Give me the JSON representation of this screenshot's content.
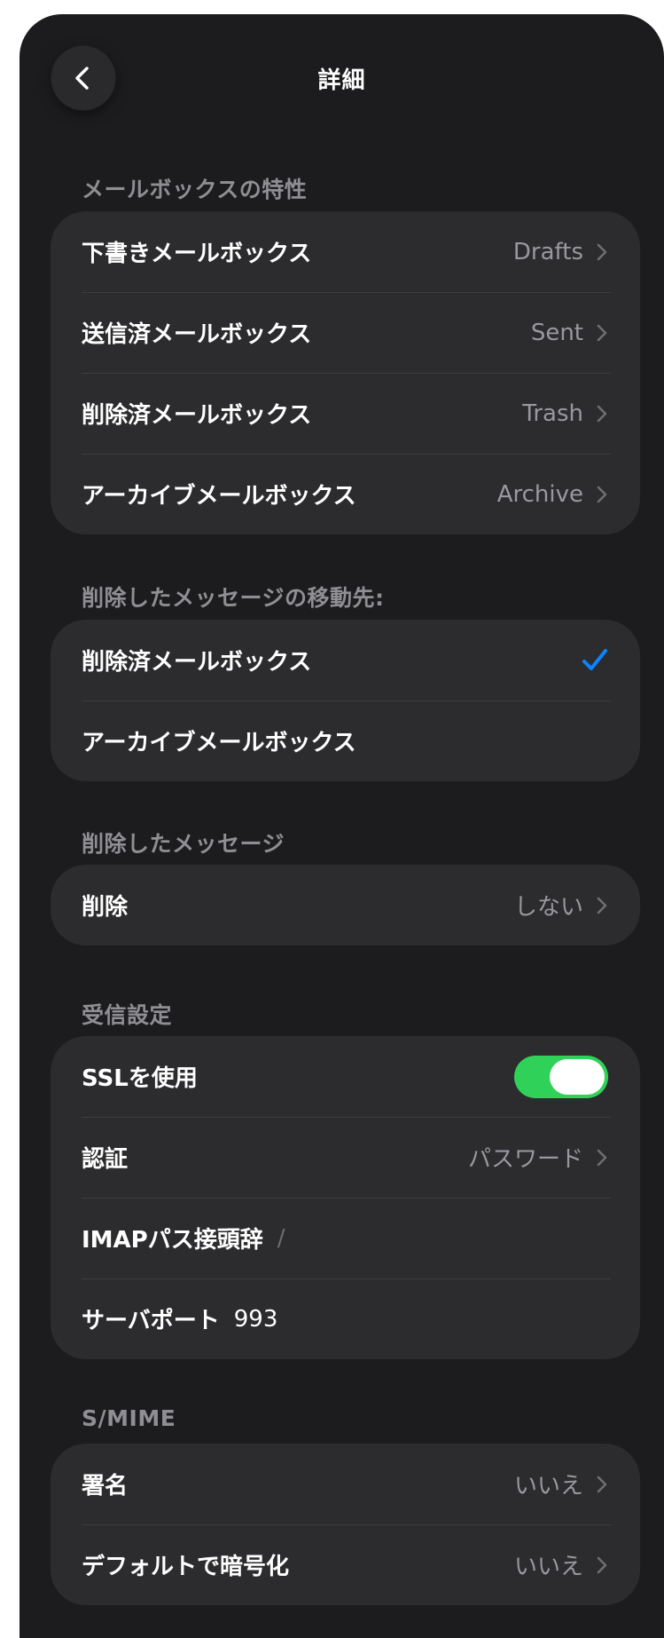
{
  "nav": {
    "title": "詳細"
  },
  "sections": {
    "mailbox": {
      "header": "メールボックスの特性",
      "rows": [
        {
          "label": "下書きメールボックス",
          "value": "Drafts"
        },
        {
          "label": "送信済メールボックス",
          "value": "Sent"
        },
        {
          "label": "削除済メールボックス",
          "value": "Trash"
        },
        {
          "label": "アーカイブメールボックス",
          "value": "Archive"
        }
      ]
    },
    "move_to": {
      "header": "削除したメッセージの移動先:",
      "rows": [
        {
          "label": "削除済メールボックス",
          "selected": true
        },
        {
          "label": "アーカイブメールボックス",
          "selected": false
        }
      ]
    },
    "deleted": {
      "header": "削除したメッセージ",
      "rows": [
        {
          "label": "削除",
          "value": "しない"
        }
      ]
    },
    "incoming": {
      "header": "受信設定",
      "ssl": {
        "label": "SSLを使用",
        "on": true
      },
      "auth": {
        "label": "認証",
        "value": "パスワード"
      },
      "imap_prefix": {
        "label": "IMAPパス接頭辞",
        "value": "/"
      },
      "server_port": {
        "label": "サーバポート",
        "value": "993"
      }
    },
    "smime": {
      "header": "S/MIME",
      "rows": [
        {
          "label": "署名",
          "value": "いいえ"
        },
        {
          "label": "デフォルトで暗号化",
          "value": "いいえ"
        }
      ]
    }
  },
  "colors": {
    "background": "#1c1c1e",
    "group": "#2c2c2e",
    "accent": "#0a84ff",
    "toggle_on": "#30d158",
    "secondary_text": "#8e8e93"
  }
}
